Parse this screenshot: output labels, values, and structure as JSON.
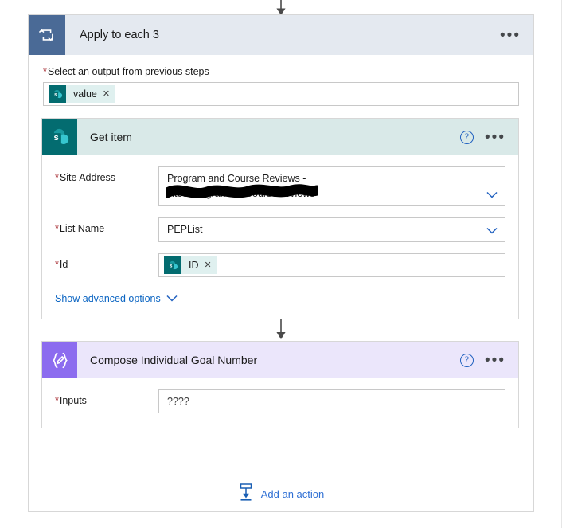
{
  "loop": {
    "title": "Apply to each 3",
    "icon": "foreach-loop-icon",
    "menu_label": "•••",
    "output_field": {
      "label": "Select an output from previous steps",
      "required_mark": "*",
      "token": {
        "text": "value",
        "icon": "sharepoint-icon",
        "remove_label": "✕"
      }
    }
  },
  "get_item": {
    "title": "Get item",
    "icon": "sharepoint-icon",
    "help_label": "?",
    "menu_label": "•••",
    "fields": [
      {
        "label": "Site Address",
        "required_mark": "*",
        "value": "Program and Course Reviews -\nsites/ProgramandCourseReviews",
        "redacted": true
      },
      {
        "label": "List Name",
        "required_mark": "*",
        "value": "PEPList",
        "redacted": false
      }
    ],
    "id_field": {
      "label": "Id",
      "required_mark": "*",
      "token": {
        "text": "ID",
        "icon": "sharepoint-icon",
        "remove_label": "✕"
      }
    },
    "advanced_options_label": "Show advanced options"
  },
  "compose": {
    "title": "Compose Individual Goal Number",
    "icon": "compose-icon",
    "help_label": "?",
    "menu_label": "•••",
    "inputs_field": {
      "label": "Inputs",
      "required_mark": "*",
      "value": "????"
    }
  },
  "add_action": {
    "label": "Add an action",
    "icon": "add-action-icon"
  },
  "colors": {
    "loop_icon_bg": "#4a6a96",
    "loop_header_bg": "#e4e9f0",
    "sharepoint_teal": "#036c70",
    "get_item_header_bg": "#d9e9e8",
    "compose_purple": "#8c6cef",
    "compose_header_bg": "#ebe6fb",
    "link_blue": "#0a64c2",
    "required_red": "#a4262c",
    "token_bg": "#dff0ef"
  }
}
